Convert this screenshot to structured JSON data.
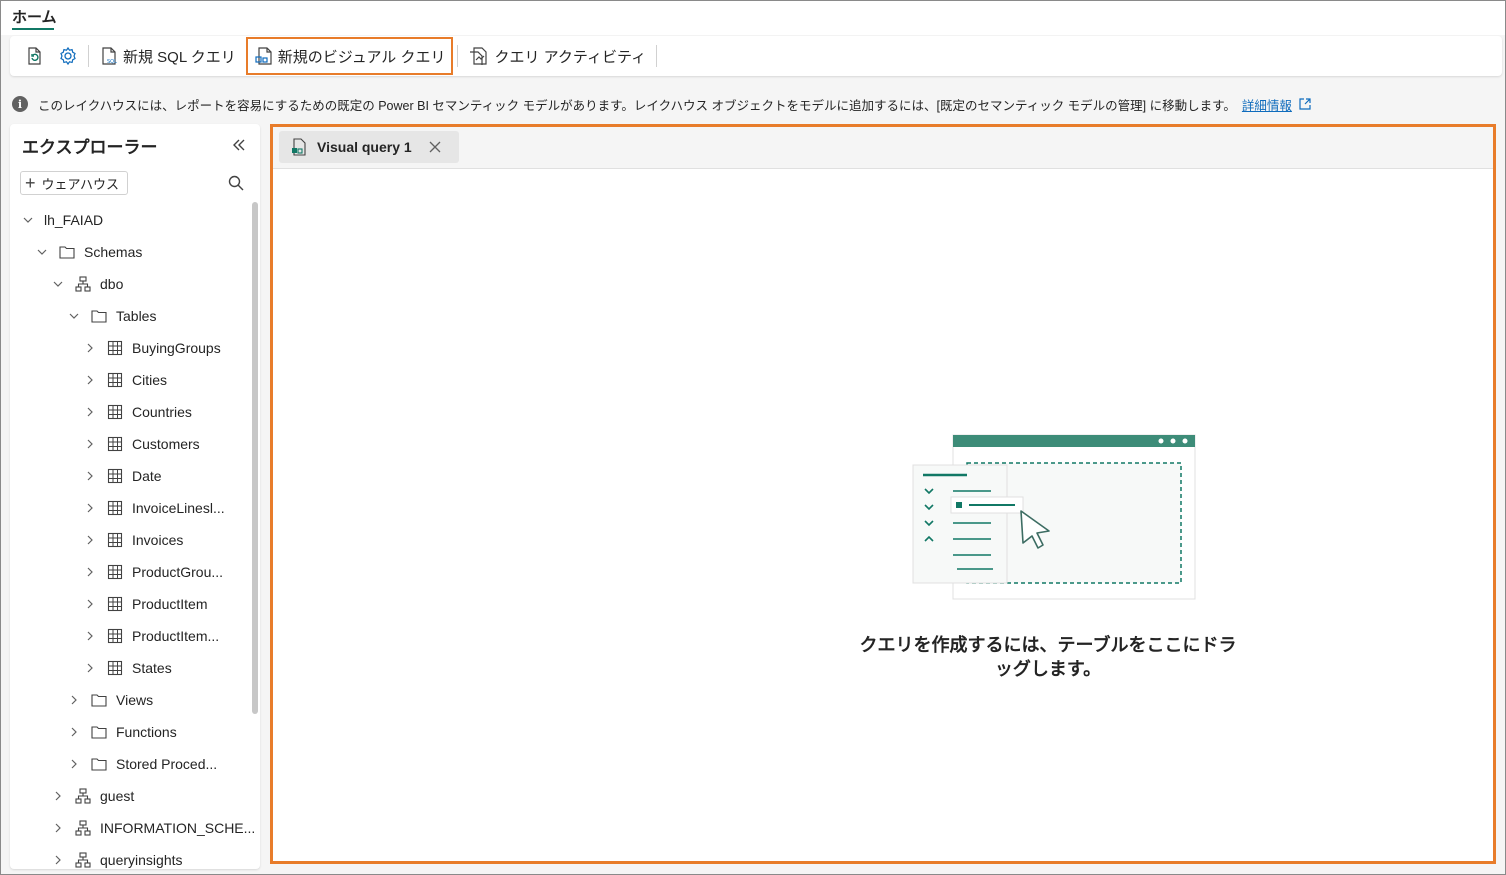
{
  "ribbon": {
    "tab_label": "ホーム"
  },
  "toolbar": {
    "new_sql_query": "新規 SQL クエリ",
    "new_visual_query": "新規のビジュアル クエリ",
    "query_activity": "クエリ アクティビティ"
  },
  "info_bar": {
    "message": "このレイクハウスには、レポートを容易にするための既定の Power BI セマンティック モデルがあります。レイクハウス オブジェクトをモデルに追加するには、[既定のセマンティック モデルの管理] に移動します。",
    "link": "詳細情報"
  },
  "explorer": {
    "title": "エクスプローラー",
    "add_button": "ウェアハウス",
    "tree": [
      {
        "label": "lh_FAIAD",
        "icon": "none",
        "expanded": true
      },
      {
        "label": "Schemas",
        "icon": "folder-icon",
        "expanded": true
      },
      {
        "label": "dbo",
        "icon": "schema-icon",
        "expanded": true
      },
      {
        "label": "Tables",
        "icon": "folder-icon",
        "expanded": true
      },
      {
        "label": "BuyingGroups",
        "icon": "table-icon",
        "expanded": false
      },
      {
        "label": "Cities",
        "icon": "table-icon",
        "expanded": false
      },
      {
        "label": "Countries",
        "icon": "table-icon",
        "expanded": false
      },
      {
        "label": "Customers",
        "icon": "table-icon",
        "expanded": false
      },
      {
        "label": "Date",
        "icon": "table-icon",
        "expanded": false
      },
      {
        "label": "InvoiceLinesl...",
        "icon": "table-icon",
        "expanded": false
      },
      {
        "label": "Invoices",
        "icon": "table-icon",
        "expanded": false
      },
      {
        "label": "ProductGrou...",
        "icon": "table-icon",
        "expanded": false
      },
      {
        "label": "ProductItem",
        "icon": "table-icon",
        "expanded": false
      },
      {
        "label": "ProductItem...",
        "icon": "table-icon",
        "expanded": false
      },
      {
        "label": "States",
        "icon": "table-icon",
        "expanded": false
      },
      {
        "label": "Views",
        "icon": "folder-icon",
        "expanded": false
      },
      {
        "label": "Functions",
        "icon": "folder-icon",
        "expanded": false
      },
      {
        "label": "Stored Proced...",
        "icon": "folder-icon",
        "expanded": false
      },
      {
        "label": "guest",
        "icon": "schema-icon",
        "expanded": false
      },
      {
        "label": "INFORMATION_SCHE...",
        "icon": "schema-icon",
        "expanded": false
      },
      {
        "label": "queryinsights",
        "icon": "schema-icon",
        "expanded": false
      }
    ]
  },
  "editor": {
    "tab_title": "Visual query 1",
    "empty_message_line1": "クエリを作成するには、テーブルをここにドラ",
    "empty_message_line2": "ッグします。"
  },
  "colors": {
    "accent": "#117865",
    "highlight": "#e87c2a",
    "link": "#0f6cbd"
  }
}
